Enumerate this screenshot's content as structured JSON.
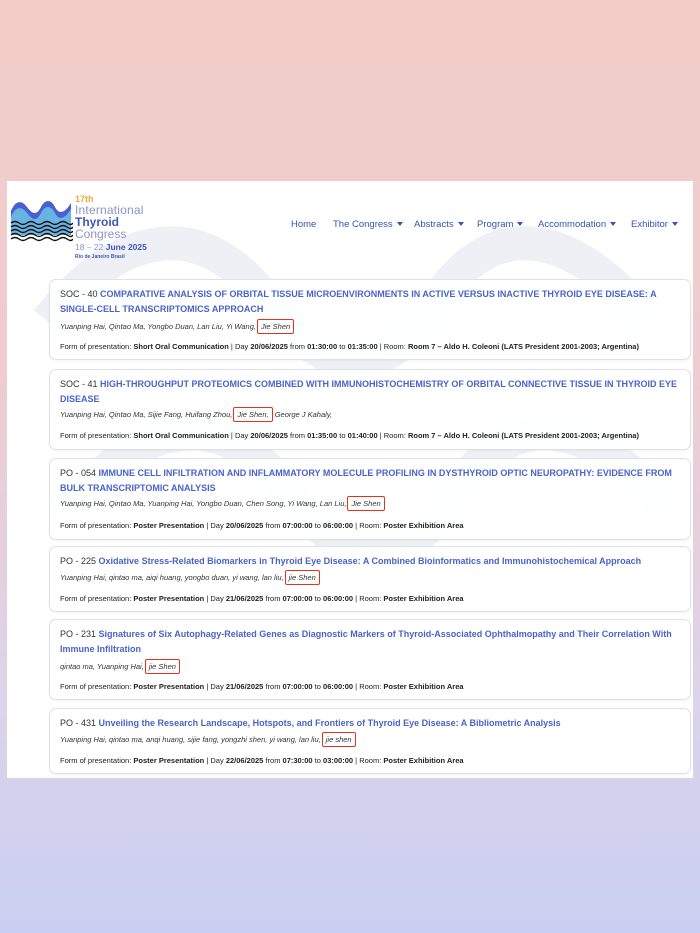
{
  "logo": {
    "line1": "17th",
    "line2": "International",
    "line3": "Thyroid",
    "line4": "Congress",
    "dates_prefix": "18 – 22",
    "dates_bold": "June 2025",
    "city": "Rio de Janeiro Brasil"
  },
  "nav": {
    "items": [
      {
        "label": "Home",
        "dropdown": false
      },
      {
        "label": "The Congress",
        "dropdown": true
      },
      {
        "label": "Abstracts",
        "dropdown": true
      },
      {
        "label": "Program",
        "dropdown": true
      },
      {
        "label": "Accommodation",
        "dropdown": true
      },
      {
        "label": "Exhibitor",
        "dropdown": true
      }
    ]
  },
  "form_label": "Form of presentation:",
  "day_label": "Day",
  "from_label": "from",
  "to_label": "to",
  "room_label": "Room:",
  "entries": [
    {
      "code": "SOC - 40",
      "title": "COMPARATIVE ANALYSIS OF ORBITAL TISSUE MICROENVIRONMENTS IN ACTIVE VERSUS INACTIVE THYROID EYE DISEASE: A SINGLE-CELL TRANSCRIPTOMICS APPROACH",
      "authors": "Yuanping Hai, Qintao Ma, Yongbo Duan, Lan Liu, Yi Wang,",
      "highlight": "Jie Shen",
      "authors_after": "",
      "form": "Short Oral Communication",
      "day": "20/06/2025",
      "from": "01:30:00",
      "to": "01:35:00",
      "room": "Room 7 – Aldo H. Coleoni (LATS President 2001-2003; Argentina)"
    },
    {
      "code": "SOC - 41",
      "title": "HIGH-THROUGHPUT PROTEOMICS COMBINED WITH IMMUNOHISTOCHEMISTRY OF ORBITAL CONNECTIVE TISSUE IN THYROID EYE DISEASE",
      "authors": "Yuanping Hai, Qintao Ma, Sijie Fang, Huifang Zhou,",
      "highlight": "Jie Shen,",
      "authors_after": "George J Kahaly,",
      "form": "Short Oral Communication",
      "day": "20/06/2025",
      "from": "01:35:00",
      "to": "01:40:00",
      "room": "Room 7 – Aldo H. Coleoni (LATS President 2001-2003; Argentina)"
    },
    {
      "code": "PO - 054",
      "title": "IMMUNE CELL INFILTRATION AND INFLAMMATORY MOLECULE PROFILING IN DYSTHYROID OPTIC NEUROPATHY: EVIDENCE FROM BULK TRANSCRIPTOMIC ANALYSIS",
      "authors": "Yuanping Hai, Qintao Ma, Yuanping Hai, Yongbo Duan, Chen Song, Yi Wang, Lan Liu,",
      "highlight": "Jie Shen",
      "authors_after": "",
      "form": "Poster Presentation",
      "day": "20/06/2025",
      "from": "07:00:00",
      "to": "06:00:00",
      "room": "Poster Exhibition Area"
    },
    {
      "code": "PO - 225",
      "title": "Oxidative Stress-Related Biomarkers in Thyroid Eye Disease: A Combined Bioinformatics and Immunohistochemical Approach",
      "authors": "Yuanping Hai, qintao ma, aiqi huang, yongbo duan, yi wang, lan liu,",
      "highlight": "jie Shen",
      "authors_after": "",
      "form": "Poster Presentation",
      "day": "21/06/2025",
      "from": "07:00:00",
      "to": "06:00:00",
      "room": "Poster Exhibition Area"
    },
    {
      "code": "PO - 231",
      "title": "Signatures of Six Autophagy-Related Genes as Diagnostic Markers of Thyroid-Associated Ophthalmopathy and Their Correlation With Immune Infiltration",
      "authors": "qintao ma, Yuanping Hai,",
      "highlight": "jie Shen",
      "authors_after": "",
      "form": "Poster Presentation",
      "day": "21/06/2025",
      "from": "07:00:00",
      "to": "06:00:00",
      "room": "Poster Exhibition Area"
    },
    {
      "code": "PO - 431",
      "title": "Unveiling the Research Landscape, Hotspots, and Frontiers of Thyroid Eye Disease: A Bibliometric Analysis",
      "authors": "Yuanping Hai, qintao ma, anqi huang, sijie fang, yongzhi shen, yi wang, lan liu,",
      "highlight": "jie shen",
      "authors_after": "",
      "form": "Poster Presentation",
      "day": "22/06/2025",
      "from": "07:30:00",
      "to": "03:00:00",
      "room": "Poster Exhibition Area"
    }
  ]
}
